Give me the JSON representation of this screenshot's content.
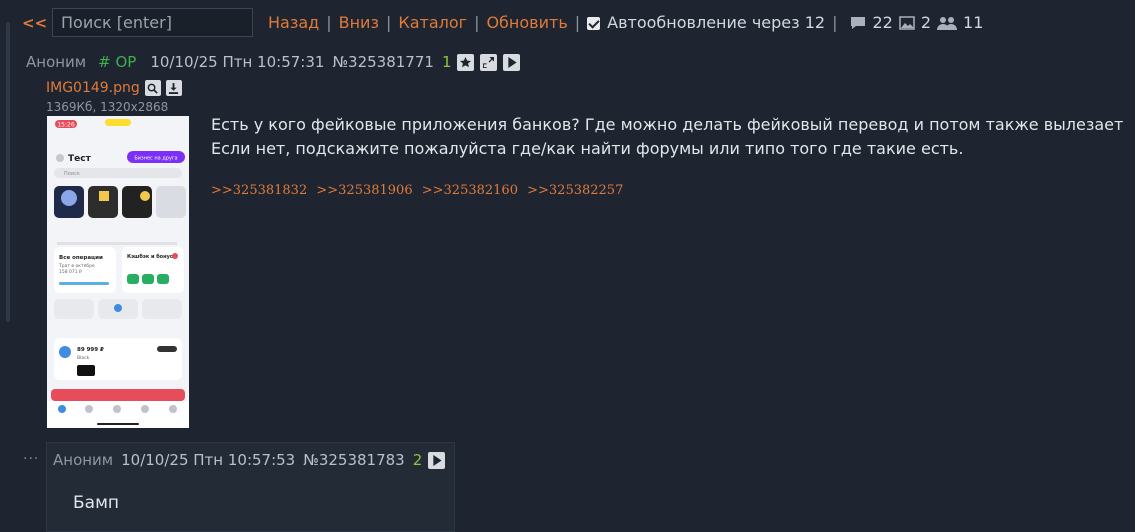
{
  "topbar": {
    "back_arrows": "<<",
    "search_placeholder": "Поиск [enter]",
    "nav": {
      "back": "Назад",
      "down": "Вниз",
      "catalog": "Каталог",
      "refresh": "Обновить"
    },
    "separator": "|",
    "autoupdate_label": "Автообновление через 12",
    "autoupdate_checked": true,
    "stats": {
      "posts": "22",
      "images": "2",
      "users": "11"
    }
  },
  "op_post": {
    "name": "Аноним",
    "op_tag": "# OP",
    "date": "10/10/25 Птн 10:57:31",
    "number": "№325381771",
    "reply_count": "1",
    "file": {
      "name": "IMG0149.png",
      "meta": "1369Кб, 1320x2868"
    },
    "thumbnail": {
      "time": "15:26",
      "title": "Тест",
      "button": "Бизнес на друга",
      "search": "Поиск",
      "ops_title": "Все операции",
      "ops_sub": "Трат в октябре",
      "ops_amount": "158 071 ₽",
      "cashback": "Кэшбэк и бонусы",
      "balance": "89 999 ₽",
      "card_label": "Black"
    },
    "text_line1": "Есть у кого фейковые приложения банков? Где можно делать фейковый перевод и потом также вылезает",
    "text_line2": "Если нет, подскажите пожалуйста где/как найти форумы или типо того где такие есть.",
    "replies": [
      ">>325381832",
      ">>325381906",
      ">>325382160",
      ">>325382257"
    ]
  },
  "reply_post": {
    "dots": "...",
    "name": "Аноним",
    "date": "10/10/25 Птн 10:57:53",
    "number": "№325381783",
    "reply_count": "2",
    "text": "Бамп"
  },
  "colors": {
    "background": "#1e2530",
    "accent": "#e07a3a",
    "op_green": "#3cb04a",
    "count_green": "#8ec43c"
  }
}
